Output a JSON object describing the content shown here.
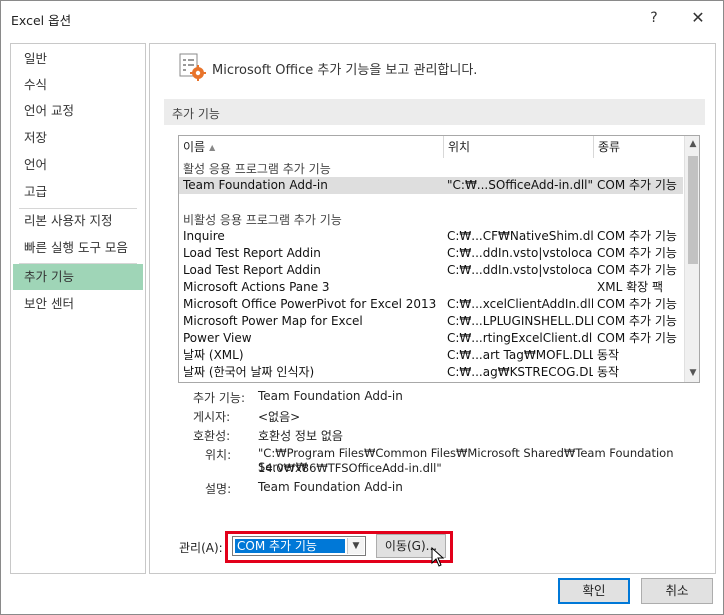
{
  "window": {
    "title": "Excel 옵션",
    "help_label": "?",
    "close_label": "✕"
  },
  "sidebar": {
    "items": [
      {
        "label": "일반"
      },
      {
        "label": "수식"
      },
      {
        "label": "언어 교정"
      },
      {
        "label": "저장"
      },
      {
        "label": "언어"
      },
      {
        "label": "고급"
      },
      {
        "label": "리본 사용자 지정"
      },
      {
        "label": "빠른 실행 도구 모음"
      },
      {
        "label": "추가 기능"
      },
      {
        "label": "보안 센터"
      }
    ],
    "active_item": "추가 기능"
  },
  "content": {
    "header_text": "Microsoft Office 추가 기능을 보고 관리합니다.",
    "section_title": "추가 기능",
    "table": {
      "columns": {
        "name": "이름",
        "location": "위치",
        "type": "종류"
      },
      "active_group_label": "활성 응용 프로그램 추가 기능",
      "active_rows": [
        {
          "name": "Team Foundation Add-in",
          "location": "\"C:₩...SOfficeAdd-in.dll\"",
          "type": "COM 추가 기능"
        }
      ],
      "inactive_group_label": "비활성 응용 프로그램 추가 기능",
      "inactive_rows": [
        {
          "name": "Inquire",
          "location": "C:₩...CF₩NativeShim.dll",
          "type": "COM 추가 기능"
        },
        {
          "name": "Load Test Report Addin",
          "location": "C:₩...ddIn.vsto|vstolocal",
          "type": "COM 추가 기능"
        },
        {
          "name": "Load Test Report Addin",
          "location": "C:₩...ddIn.vsto|vstolocal",
          "type": "COM 추가 기능"
        },
        {
          "name": "Microsoft Actions Pane 3",
          "location": "",
          "type": "XML 확장 팩"
        },
        {
          "name": "Microsoft Office PowerPivot for Excel 2013",
          "location": "C:₩...xcelClientAddIn.dll",
          "type": "COM 추가 기능"
        },
        {
          "name": "Microsoft Power Map for Excel",
          "location": "C:₩...LPLUGINSHELL.DLL",
          "type": "COM 추가 기능"
        },
        {
          "name": "Power View",
          "location": "C:₩...rtingExcelClient.dll",
          "type": "COM 추가 기능"
        },
        {
          "name": "날짜 (XML)",
          "location": "C:₩...art Tag₩MOFL.DLL",
          "type": "동작"
        },
        {
          "name": "날짜 (한국어 날짜 인식자)",
          "location": "C:₩...ag₩KSTRECOG.DLL",
          "type": "동작"
        }
      ]
    },
    "details": {
      "addin_label": "추가 기능:",
      "addin_value": "Team Foundation Add-in",
      "publisher_label": "게시자:",
      "publisher_value": "<없음>",
      "compat_label": "호환성:",
      "compat_value": "호환성 정보 없음",
      "location_label": "위치:",
      "location_value_line1": "\"C:₩Program Files₩Common Files₩Microsoft Shared₩Team Foundation Server₩",
      "location_value_line2": "14.0₩x86₩TFSOfficeAdd-in.dll\"",
      "description_label": "설명:",
      "description_value": "Team Foundation Add-in"
    },
    "manage": {
      "label": "관리(A):",
      "selected": "COM 추가 기능",
      "go_label": "이동(G)..."
    }
  },
  "footer": {
    "ok_label": "확인",
    "cancel_label": "취소"
  },
  "colors": {
    "active_nav_bg": "#9fd5b7",
    "highlight_border": "#e2001a",
    "selection_blue": "#0078d7"
  },
  "icons": [
    "help-icon",
    "close-icon",
    "addins-gear-icon",
    "sort-up-icon",
    "scroll-up-icon",
    "scroll-down-icon",
    "dropdown-arrow-icon",
    "mouse-cursor-icon"
  ]
}
